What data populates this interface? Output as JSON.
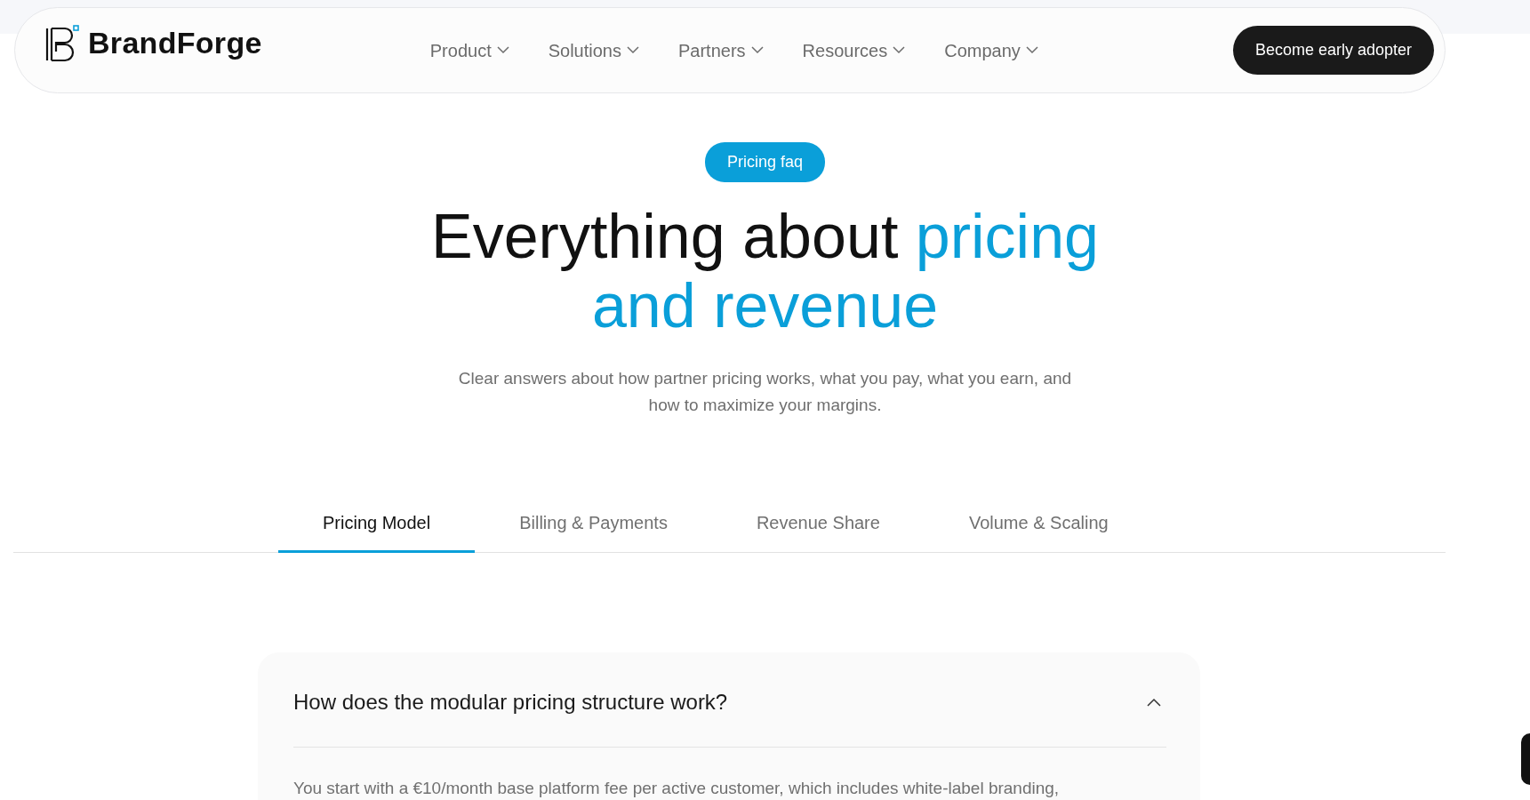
{
  "navbar": {
    "brand": "BrandForge",
    "menu": [
      {
        "label": "Product"
      },
      {
        "label": "Solutions"
      },
      {
        "label": "Partners"
      },
      {
        "label": "Resources"
      },
      {
        "label": "Company"
      }
    ],
    "cta": "Become early adopter"
  },
  "hero": {
    "badge": "Pricing faq",
    "heading_lead": "Everything about ",
    "heading_highlight": "pricing and revenue",
    "subtitle": "Clear answers about how partner pricing works, what you pay, what you earn, and how to maximize your margins."
  },
  "tabs": [
    {
      "label": "Pricing Model",
      "selected": true
    },
    {
      "label": "Billing & Payments",
      "selected": false
    },
    {
      "label": "Revenue Share",
      "selected": false
    },
    {
      "label": "Volume & Scaling",
      "selected": false
    }
  ],
  "faq": [
    {
      "question": "How does the modular pricing structure work?",
      "expanded": true,
      "answer": "You start with a €10/month base platform fee per active customer, which includes white-label branding,"
    }
  ]
}
